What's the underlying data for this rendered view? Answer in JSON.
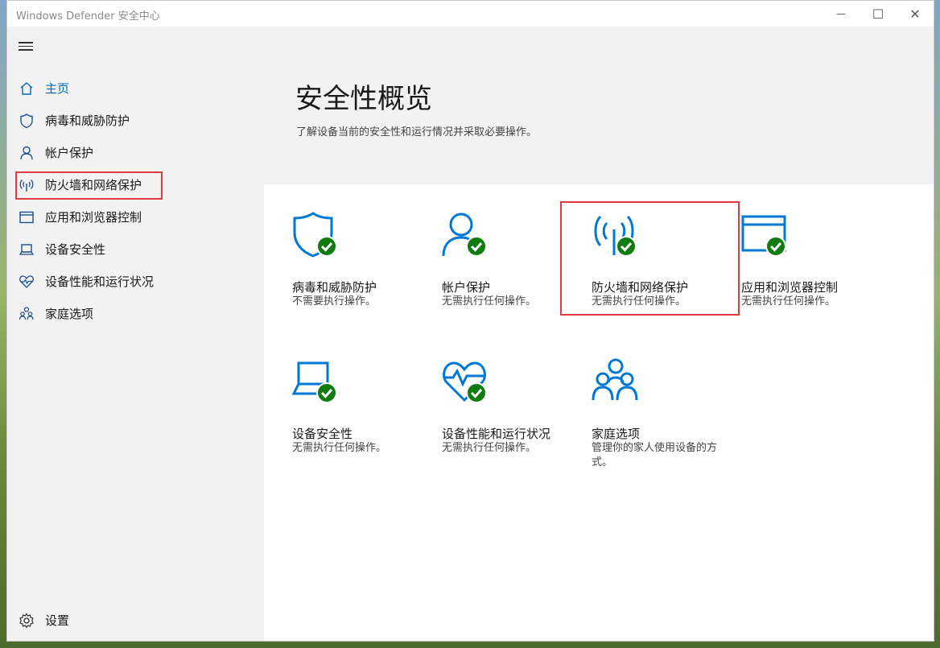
{
  "window": {
    "title": "Windows Defender 安全中心",
    "minimize_glyph": "—",
    "maximize_glyph": "☐",
    "close_glyph": "✕"
  },
  "sidebar": {
    "items": [
      {
        "label": "主页",
        "icon": "home-icon",
        "active": true
      },
      {
        "label": "病毒和威胁防护",
        "icon": "shield-icon"
      },
      {
        "label": "帐户保护",
        "icon": "person-icon"
      },
      {
        "label": "防火墙和网络保护",
        "icon": "wireless-icon",
        "highlighted": true
      },
      {
        "label": "应用和浏览器控制",
        "icon": "browser-window-icon"
      },
      {
        "label": "设备安全性",
        "icon": "laptop-icon"
      },
      {
        "label": "设备性能和运行状况",
        "icon": "heart-pulse-icon"
      },
      {
        "label": "家庭选项",
        "icon": "family-icon"
      }
    ],
    "settings_label": "设置"
  },
  "main": {
    "title": "安全性概览",
    "subtitle": "了解设备当前的安全性和运行情况并采取必要操作。",
    "tiles": [
      {
        "title": "病毒和威胁防护",
        "desc": "不需要执行操作。",
        "icon": "shield-icon",
        "status": "ok"
      },
      {
        "title": "帐户保护",
        "desc": "无需执行任何操作。",
        "icon": "person-icon",
        "status": "ok"
      },
      {
        "title": "防火墙和网络保护",
        "desc": "无需执行任何操作。",
        "icon": "wireless-icon",
        "status": "ok",
        "highlighted": true
      },
      {
        "title": "应用和浏览器控制",
        "desc": "无需执行任何操作。",
        "icon": "browser-window-icon",
        "status": "ok"
      },
      {
        "title": "设备安全性",
        "desc": "无需执行任何操作。",
        "icon": "laptop-icon",
        "status": "ok"
      },
      {
        "title": "设备性能和运行状况",
        "desc": "无需执行任何操作。",
        "icon": "heart-pulse-icon",
        "status": "ok"
      },
      {
        "title": "家庭选项",
        "desc": "管理你的家人使用设备的方式。",
        "icon": "family-icon"
      }
    ]
  },
  "colors": {
    "accent": "#0067c0",
    "icon_blue": "#0078d4",
    "ok_green": "#107c10",
    "highlight_red": "#e0393e"
  }
}
